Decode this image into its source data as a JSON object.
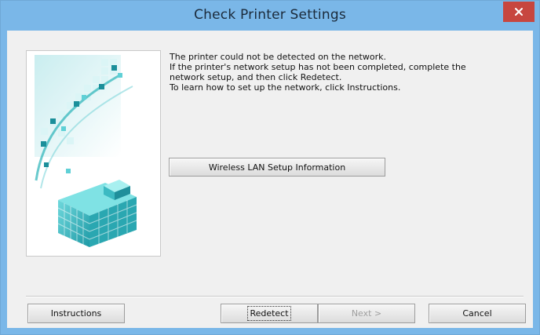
{
  "window": {
    "title": "Check Printer Settings",
    "close_label": "×"
  },
  "message": {
    "lines": [
      "The printer could not be detected on the network.",
      "If the printer's network setup has not been completed, complete the",
      "network setup, and then click Redetect.",
      "To learn how to set up the network, click Instructions."
    ]
  },
  "buttons": {
    "wireless_info": "Wireless LAN Setup Information",
    "instructions": "Instructions",
    "redetect": "Redetect",
    "next": "Next >",
    "cancel": "Cancel"
  },
  "colors": {
    "titlebar": "#7ab7e8",
    "close": "#c7463f",
    "illustration_accent": "#2ab3b8"
  },
  "icons": {
    "close": "close-icon",
    "illustration": "cube-illustration"
  }
}
